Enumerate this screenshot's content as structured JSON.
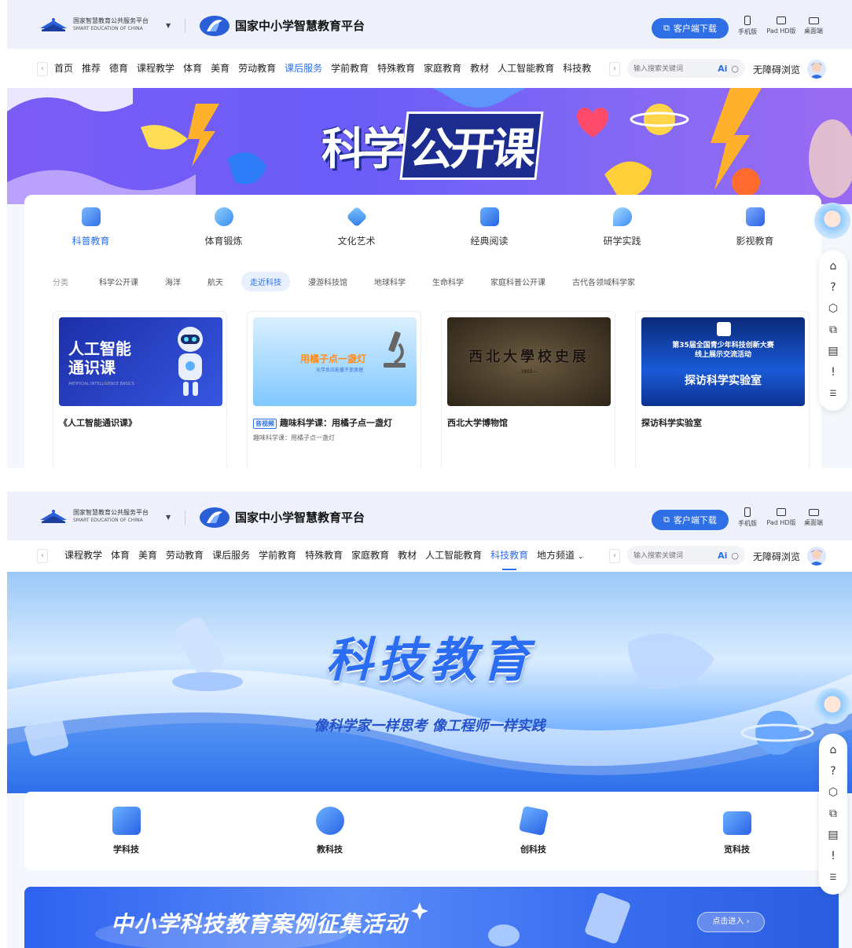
{
  "header": {
    "platform_cn": "国家智慧教育公共服务平台",
    "platform_en": "SMART EDUCATION OF CHINA",
    "site_name": "国家中小学智慧教育平台",
    "download_label": "客户端下载",
    "devices": [
      "手机版",
      "Pad HD版",
      "桌面端"
    ]
  },
  "search": {
    "placeholder": "输入搜索关键词",
    "ai_label": "Ai"
  },
  "accessibility_label": "无障碍浏览",
  "screen1": {
    "nav_items": [
      "首页",
      "推荐",
      "德育",
      "课程教学",
      "体育",
      "美育",
      "劳动教育",
      "课后服务",
      "学前教育",
      "特殊教育",
      "家庭教育",
      "教材",
      "人工智能教育",
      "科技教"
    ],
    "nav_active": "课后服务",
    "banner_title_a": "科学",
    "banner_title_b": "公开课",
    "categories": [
      "科普教育",
      "体育锻炼",
      "文化艺术",
      "经典阅读",
      "研学实践",
      "影视教育"
    ],
    "sub_label": "分类",
    "sub_items": [
      "科学公开课",
      "海洋",
      "航天",
      "走近科技",
      "漫游科技馆",
      "地球科学",
      "生命科学",
      "家庭科普公开课",
      "古代各领域科学家"
    ],
    "sub_active": "走近科技",
    "cards": [
      {
        "thumb_text": "人工智能\n通识课",
        "thumb_sub": "ARTIFICIAL INTELLIGENCE BASICS",
        "title": "《人工智能通识课》"
      },
      {
        "thumb_text": "用橘子点一盏灯",
        "thumb_sub": "化学反应能量不变原理",
        "tag": "音视频",
        "title": "趣味科学课：用橘子点一盏灯",
        "subtitle": "趣味科学课：用橘子点一盏灯"
      },
      {
        "thumb_text": "西北大學校史展",
        "thumb_sub": "1902—",
        "title": "西北大学博物馆"
      },
      {
        "thumb_text": "第35届全国青少年科技创新大赛\n线上展示交流活动",
        "thumb_sub": "探访科学实验室",
        "title": "探访科学实验室"
      }
    ]
  },
  "screen2": {
    "nav_items": [
      "课程教学",
      "体育",
      "美育",
      "劳动教育",
      "课后服务",
      "学前教育",
      "特殊教育",
      "家庭教育",
      "教材",
      "人工智能教育",
      "科技教育",
      "地方频道"
    ],
    "nav_active": "科技教育",
    "banner_title": "科技教育",
    "banner_slogan": "像科学家一样思考 像工程师一样实践",
    "tiles": [
      "学科技",
      "教科技",
      "创科技",
      "览科技"
    ],
    "promo_title": "中小学科技教育案例征集活动",
    "promo_button": "点击进入 ›"
  },
  "sidebar_icons": [
    "home-icon",
    "help-icon",
    "cube-icon",
    "copy-icon",
    "notes-icon",
    "feedback-icon",
    "menu-icon"
  ]
}
